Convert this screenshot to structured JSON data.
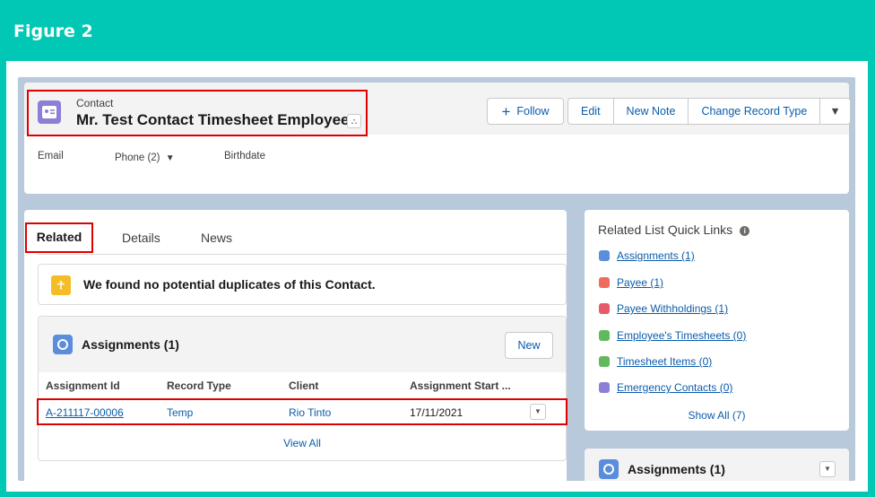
{
  "figure": {
    "title": "Figure 2"
  },
  "header": {
    "object_label": "Contact",
    "record_name": "Mr. Test Contact Timesheet Employee",
    "buttons": {
      "follow": "Follow",
      "edit": "Edit",
      "new_note": "New Note",
      "change_record_type": "Change Record Type"
    },
    "fields": {
      "email": "Email",
      "phone": "Phone (2)",
      "birthdate": "Birthdate"
    }
  },
  "tabs": {
    "related": "Related",
    "details": "Details",
    "news": "News"
  },
  "duplicates": {
    "message": "We found no potential duplicates of this Contact."
  },
  "assignments": {
    "title": "Assignments (1)",
    "new_label": "New",
    "columns": [
      "Assignment Id",
      "Record Type",
      "Client",
      "Assignment Start ..."
    ],
    "row": {
      "id": "A-211117-00006",
      "record_type": "Temp",
      "client": "Rio Tinto",
      "start": "17/11/2021"
    },
    "view_all": "View All"
  },
  "quick_links": {
    "title": "Related List Quick Links",
    "items": [
      {
        "label": "Assignments (1)",
        "color": "#5a8ddb"
      },
      {
        "label": "Payee (1)",
        "color": "#f06b5b"
      },
      {
        "label": "Payee Withholdings (1)",
        "color": "#e8596a"
      },
      {
        "label": "Employee's Timesheets (0)",
        "color": "#62b95d"
      },
      {
        "label": "Timesheet Items (0)",
        "color": "#62b95d"
      },
      {
        "label": "Emergency Contacts (0)",
        "color": "#8c7fd6"
      }
    ],
    "show_all": "Show All (7)"
  },
  "side_assignments": {
    "title": "Assignments (1)"
  }
}
